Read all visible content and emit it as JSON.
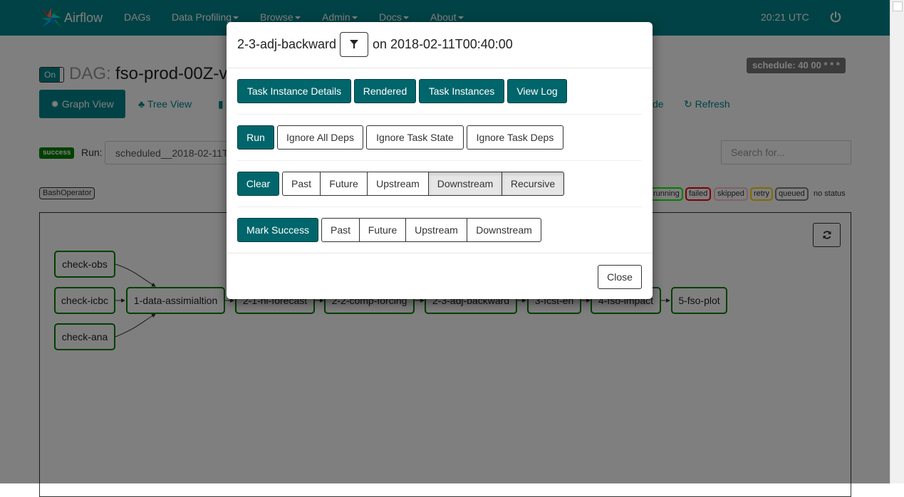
{
  "navbar": {
    "brand": "Airflow",
    "items": [
      {
        "label": "DAGs",
        "dropdown": false
      },
      {
        "label": "Data Profiling",
        "dropdown": true
      },
      {
        "label": "Browse",
        "dropdown": true
      },
      {
        "label": "Admin",
        "dropdown": true
      },
      {
        "label": "Docs",
        "dropdown": true
      },
      {
        "label": "About",
        "dropdown": true
      }
    ],
    "clock": "20:21 UTC",
    "power_icon": "power-icon",
    "color": "#00858a"
  },
  "dag": {
    "toggle": "On",
    "prefix": "DAG:",
    "name": "fso-prod-00Z-v",
    "schedule": "schedule: 40 00 * * *"
  },
  "views": {
    "graph": "Graph View",
    "tree": "Tree View",
    "code_partial": "de",
    "refresh": "Refresh"
  },
  "run_bar": {
    "status": "success",
    "label": "Run:",
    "selected": "scheduled__2018-02-11T",
    "search_placeholder": "Search for..."
  },
  "legend": {
    "operator": "BashOperator",
    "states": [
      {
        "label": "running",
        "color": "#00ff00"
      },
      {
        "label": "failed",
        "color": "#ff0000"
      },
      {
        "label": "skipped",
        "color": "#ffc0cb"
      },
      {
        "label": "retry",
        "color": "#ffd700"
      },
      {
        "label": "queued",
        "color": "#808080"
      }
    ],
    "no_status": "no status"
  },
  "graph": {
    "nodes": [
      "check-obs",
      "check-icbc",
      "check-ana",
      "1-data-assimialtion",
      "2-1-nl-forecast",
      "2-2-comp-forcing",
      "2-3-adj-backward",
      "3-fcst-en",
      "4-fso-impact",
      "5-fso-plot"
    ]
  },
  "modal": {
    "task": "2-3-adj-backward",
    "filter_icon": "filter-icon",
    "on_date": "on 2018-02-11T00:40:00",
    "nav_buttons": [
      "Task Instance Details",
      "Rendered",
      "Task Instances",
      "View Log"
    ],
    "run": {
      "action": "Run",
      "options": [
        "Ignore All Deps",
        "Ignore Task State",
        "Ignore Task Deps"
      ]
    },
    "clear": {
      "action": "Clear",
      "options": [
        {
          "label": "Past",
          "active": false
        },
        {
          "label": "Future",
          "active": false
        },
        {
          "label": "Upstream",
          "active": false
        },
        {
          "label": "Downstream",
          "active": true
        },
        {
          "label": "Recursive",
          "active": true
        }
      ]
    },
    "mark_success": {
      "action": "Mark Success",
      "options": [
        {
          "label": "Past",
          "active": false
        },
        {
          "label": "Future",
          "active": false
        },
        {
          "label": "Upstream",
          "active": false
        },
        {
          "label": "Downstream",
          "active": false
        }
      ]
    },
    "close": "Close"
  }
}
